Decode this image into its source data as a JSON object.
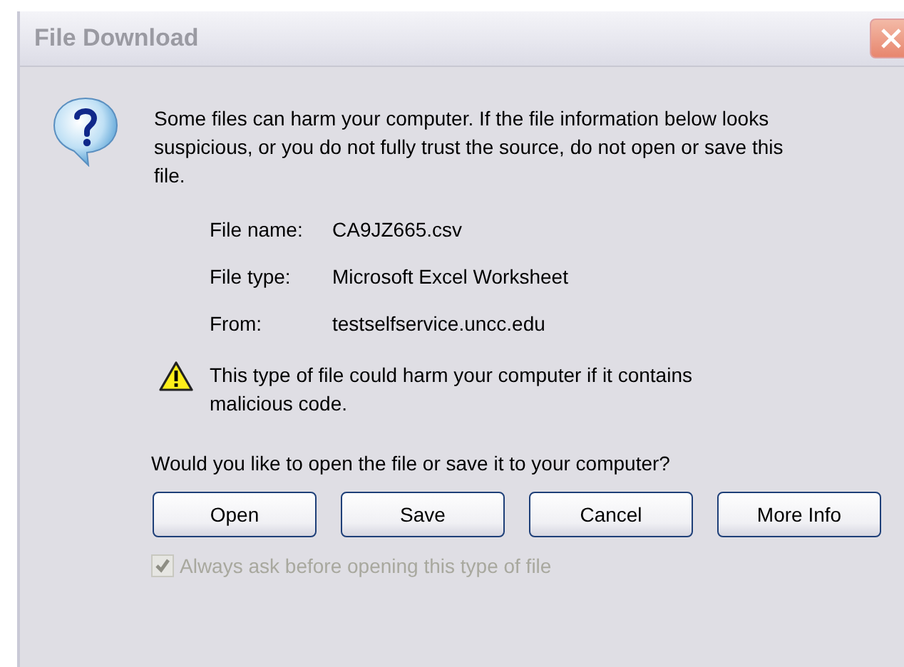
{
  "window": {
    "title": "File Download",
    "active": false
  },
  "message": "Some files can harm your computer. If the file information below looks suspicious, or you do not fully trust the source, do not open or save this file.",
  "fields": [
    {
      "label": "File name:",
      "value": "CA9JZ665.csv"
    },
    {
      "label": "File type:",
      "value": "Microsoft Excel Worksheet"
    },
    {
      "label": "From:",
      "value": "testselfservice.uncc.edu"
    }
  ],
  "warning": "This type of file could harm your computer if it contains malicious code.",
  "question": "Would you like to open the file or save it to your computer?",
  "buttons": [
    "Open",
    "Save",
    "Cancel",
    "More Info"
  ],
  "checkbox": {
    "label": "Always ask before opening this type of file",
    "checked": true,
    "disabled": true
  }
}
